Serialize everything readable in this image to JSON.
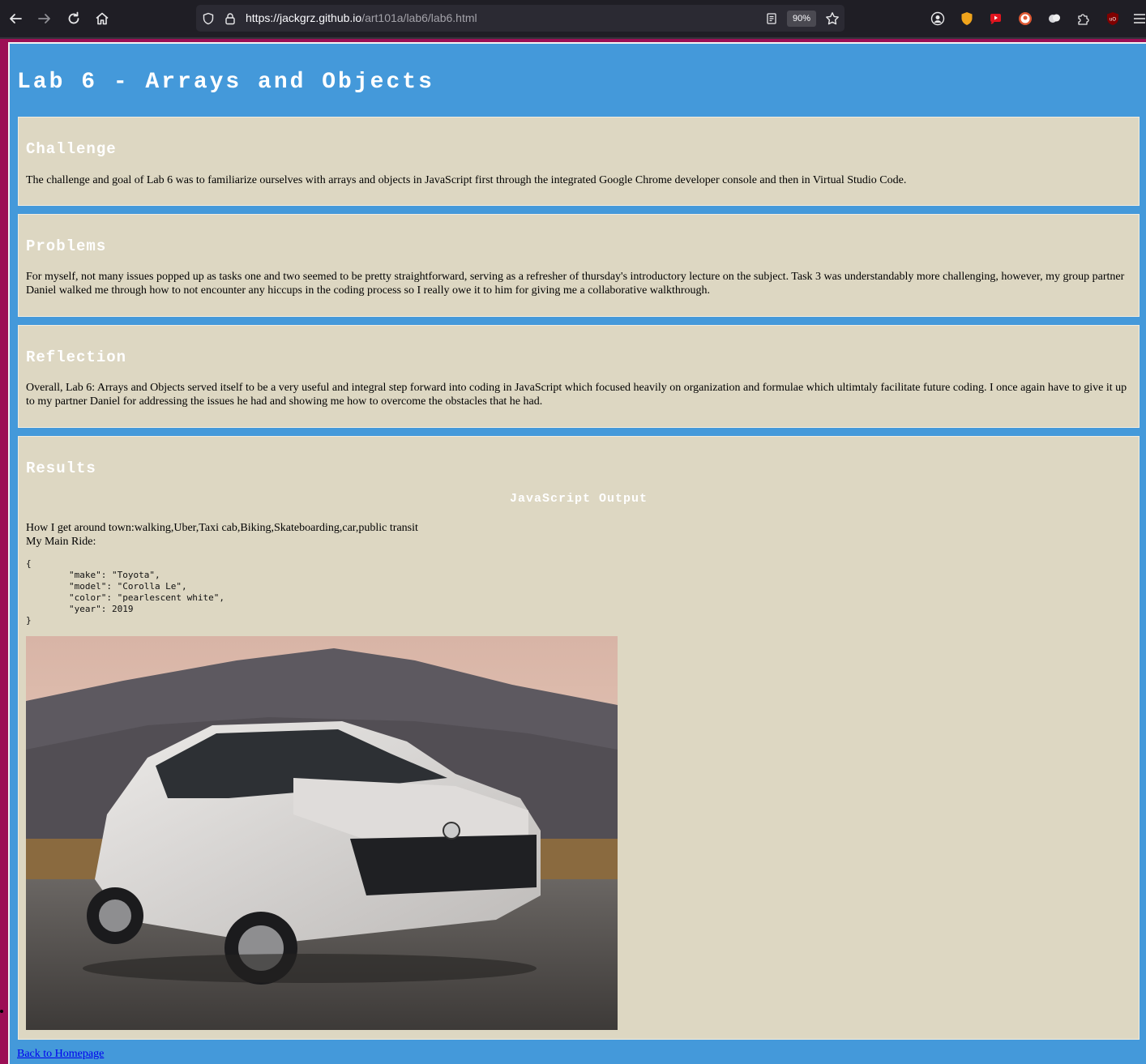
{
  "browser": {
    "url_domain": "https://jackgrz.github.io",
    "url_path": "/art101a/lab6/lab6.html",
    "zoom": "90%"
  },
  "page": {
    "title": "Lab 6 - Arrays and Objects",
    "sections": [
      {
        "heading": "Challenge",
        "text": "The challenge and goal of Lab 6 was to familiarize ourselves with arrays and objects in JavaScript first through the integrated Google Chrome developer console and then in Virtual Studio Code."
      },
      {
        "heading": "Problems",
        "text": "For myself, not many issues popped up as tasks one and two seemed to be pretty straightforward, serving as a refresher of thursday's introductory lecture on the subject. Task 3 was understandably more challenging, however, my group partner Daniel walked me through how to not encounter any hiccups in the coding process so I really owe it to him for giving me a collaborative walkthrough."
      },
      {
        "heading": "Reflection",
        "text": "Overall, Lab 6: Arrays and Objects served itself to be a very useful and integral step forward into coding in JavaScript which focused heavily on organization and formulae which ultimtaly facilitate future coding. I once again have to give it up to my partner Daniel for addressing the issues he had and showing me how to overcome the obstacles that he had."
      }
    ],
    "results": {
      "heading": "Results",
      "output_heading": "JavaScript Output",
      "transport_line": "How I get around town:walking,Uber,Taxi cab,Biking,Skateboarding,car,public transit",
      "main_ride_label": "My Main Ride:",
      "code": "{\n        \"make\": \"Toyota\",\n        \"model\": \"Corolla Le\",\n        \"color\": \"pearlescent white\",\n        \"year\": 2019\n}"
    },
    "back_link": "Back to Homepage"
  },
  "colors": {
    "page_bg": "#4499da",
    "section_bg": "#ddd7c2",
    "outer_bg": "#9c0f55",
    "toolbar_bg": "#1f1e25"
  }
}
